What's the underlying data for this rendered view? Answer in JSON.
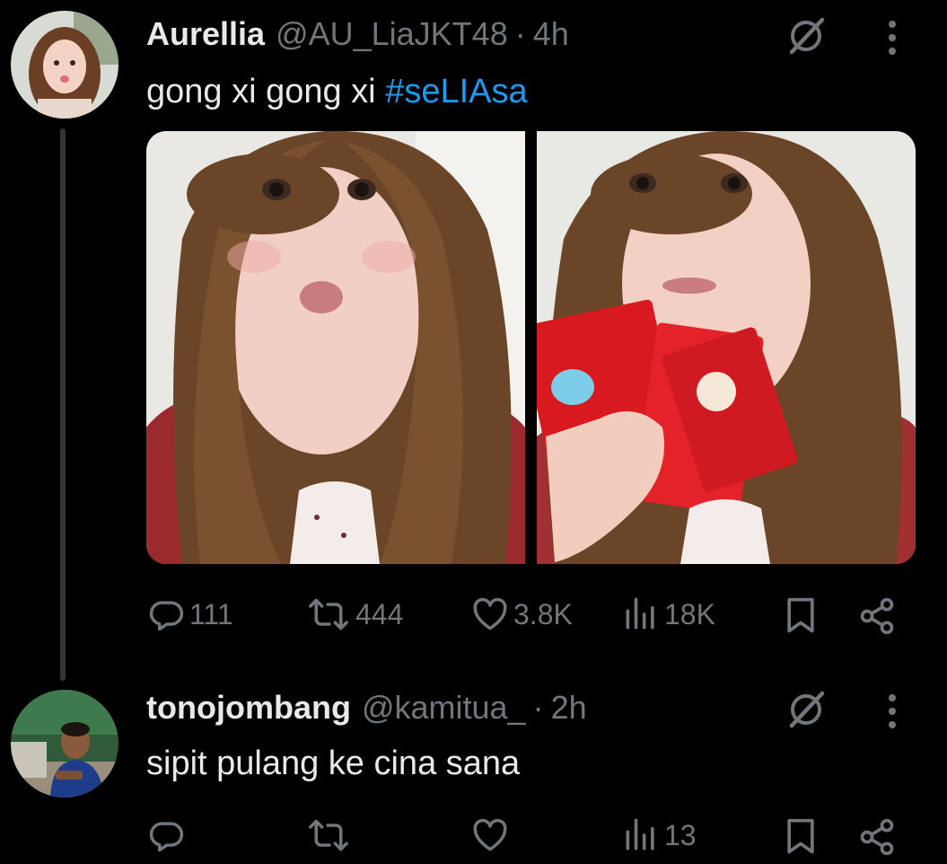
{
  "tweets": [
    {
      "display_name": "Aurellia",
      "handle": "@AU_LiaJKT48",
      "separator": "·",
      "time": "4h",
      "text": "gong xi gong xi ",
      "hashtag": "#seLIAsa",
      "stats": {
        "replies": "111",
        "reposts": "444",
        "likes": "3.8K",
        "views": "18K"
      }
    },
    {
      "display_name": "tonojombang",
      "handle": "@kamitua_",
      "separator": "·",
      "time": "2h",
      "text": "sipit pulang ke cina sana",
      "stats": {
        "replies": "",
        "reposts": "",
        "likes": "",
        "views": "13"
      }
    }
  ],
  "icons": {
    "reply": "reply-icon",
    "repost": "repost-icon",
    "like": "heart-icon",
    "views": "views-chart-icon",
    "bookmark": "bookmark-icon",
    "share": "share-icon",
    "grok": "grok-icon",
    "more": "more-vertical-icon"
  },
  "colors": {
    "background": "#000000",
    "text_primary": "#e7e9ea",
    "text_secondary": "#71767b",
    "hashtag": "#1d9bf0",
    "thread_line": "#333639"
  }
}
